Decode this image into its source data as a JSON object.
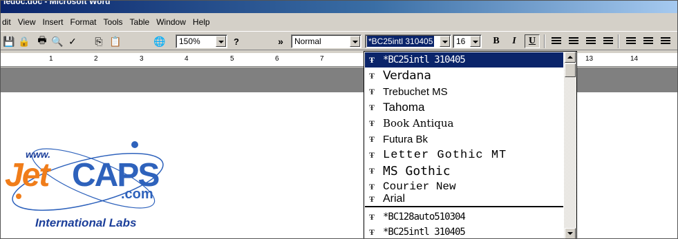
{
  "window": {
    "title": "ledoc.doc - Microsoft Word"
  },
  "menu": [
    "dit",
    "View",
    "Insert",
    "Format",
    "Tools",
    "Table",
    "Window",
    "Help"
  ],
  "toolbar": {
    "zoom": "150%",
    "style": "Normal",
    "font": "*BC25intl 310405",
    "size": "16",
    "bold": "B",
    "italic": "I",
    "underline": "U",
    "more": "»",
    "help": "?"
  },
  "ruler": [
    "1",
    "2",
    "3",
    "4",
    "5",
    "6",
    "7",
    "13",
    "14"
  ],
  "logo": {
    "www": "www.",
    "jet": "Jet",
    "caps": "CAPS",
    "com": ".com",
    "labs": "International Labs"
  },
  "font_list": {
    "recent": [
      "*BC25intl 310405",
      "Verdana",
      "Trebuchet MS",
      "Tahoma",
      "Book Antiqua",
      "Futura Bk",
      "Letter Gothic MT",
      "MS Gothic",
      "Courier New",
      "Arial"
    ],
    "all": [
      "*BC128auto510304",
      "*BC25intl 310405"
    ]
  }
}
